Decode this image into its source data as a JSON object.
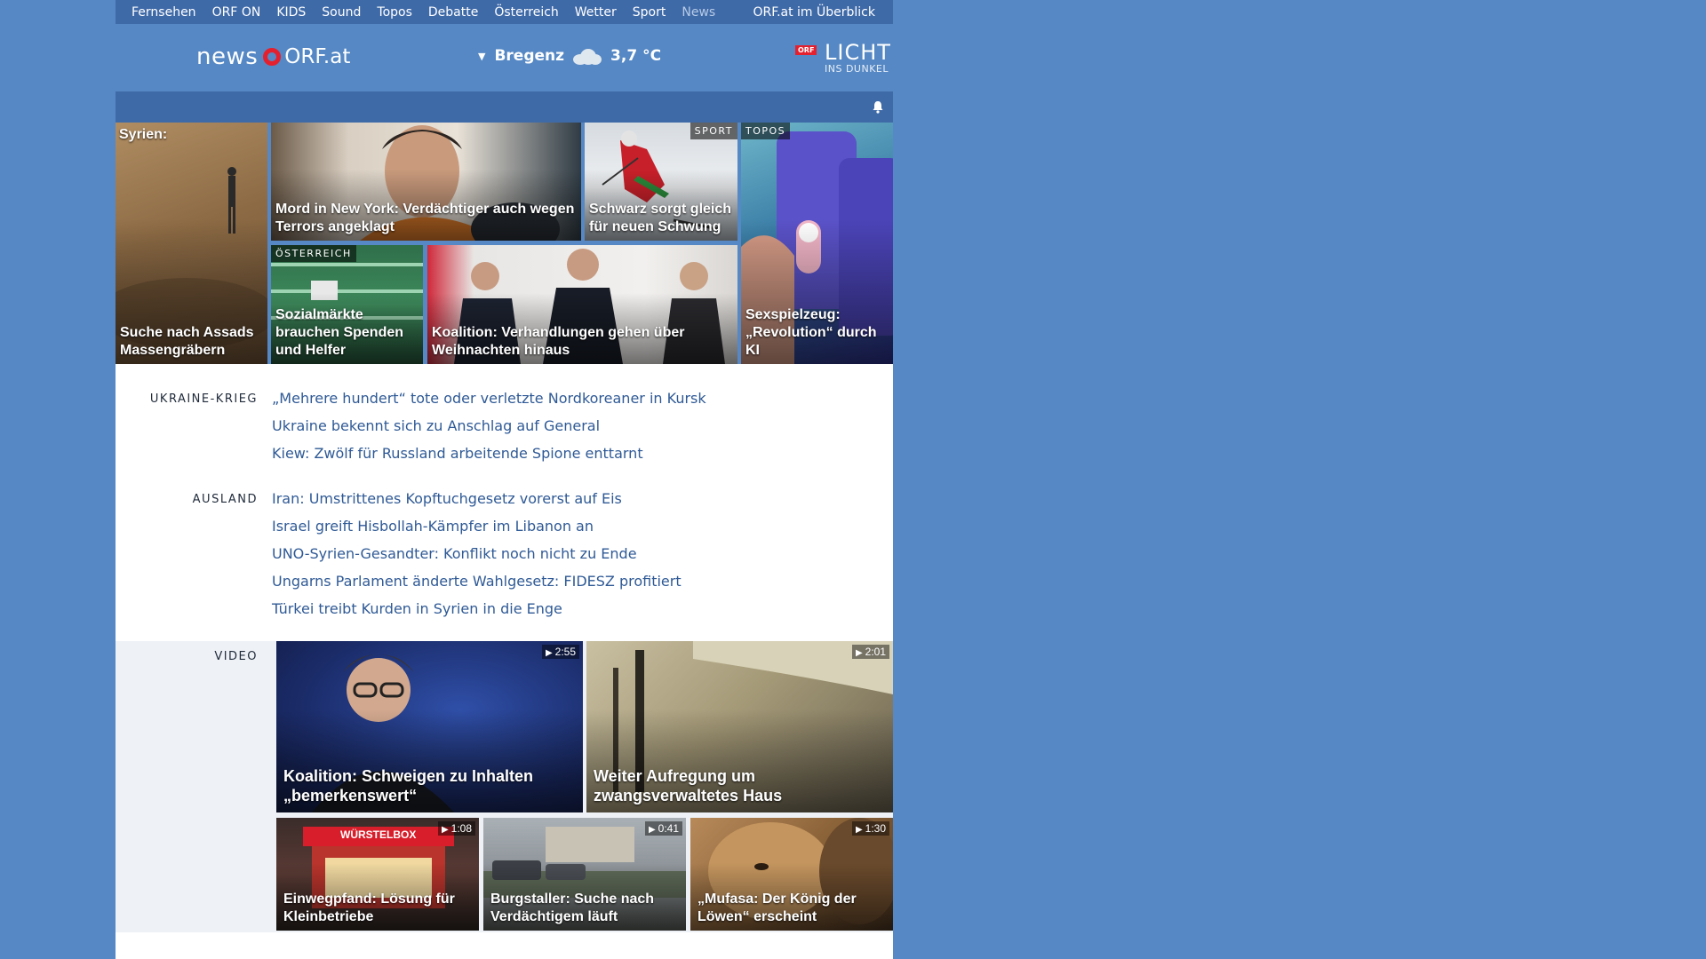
{
  "topnav": {
    "items": [
      "Fernsehen",
      "ORF ON",
      "KIDS",
      "Sound",
      "Topos",
      "Debatte",
      "Österreich",
      "Wetter",
      "Sport",
      "News"
    ],
    "overview": "ORF.at im Überblick"
  },
  "header": {
    "logo_news": "news",
    "logo_orf": "ORF.at",
    "weather_city": "Bregenz",
    "weather_temp": "3,7 °C",
    "licht_badge": "ORF",
    "licht_big": "LICHT",
    "licht_small": "INS DUNKEL"
  },
  "teasers": {
    "syrien": {
      "label": "Syrien:",
      "caption": "Suche nach Assads Massengräbern"
    },
    "newyork": {
      "caption": "Mord in New York: Verdächtiger auch wegen Terrors angeklagt"
    },
    "sport": {
      "tag": "SPORT",
      "caption": "Schwarz sorgt gleich für neuen Schwung"
    },
    "topos": {
      "tag": "TOPOS",
      "caption": "Sexspielzeug: „Revolution“ durch KI"
    },
    "oesterreich": {
      "tag": "ÖSTERREICH",
      "caption": "Sozialmärkte brauchen Spenden und Helfer"
    },
    "koalition": {
      "caption": "Koalition: Verhandlungen gehen über Weihnachten hinaus"
    }
  },
  "sections": {
    "ukraine": {
      "label": "UKRAINE-KRIEG",
      "stories": [
        "„Mehrere hundert“ tote oder verletzte Nordkoreaner in Kursk",
        "Ukraine bekennt sich zu Anschlag auf General",
        "Kiew: Zwölf für Russland arbeitende Spione enttarnt"
      ]
    },
    "ausland": {
      "label": "AUSLAND",
      "stories": [
        "Iran: Umstrittenes Kopftuchgesetz vorerst auf Eis",
        "Israel greift Hisbollah-Kämpfer im Libanon an",
        "UNO-Syrien-Gesandter: Konflikt noch nicht zu Ende",
        "Ungarns Parlament änderte Wahlgesetz: FIDESZ profitiert",
        "Türkei treibt Kurden in Syrien in die Enge"
      ]
    }
  },
  "video": {
    "label": "VIDEO",
    "items": [
      {
        "duration": "2:55",
        "caption": "Koalition: Schweigen zu Inhalten „bemerkenswert“"
      },
      {
        "duration": "2:01",
        "caption": "Weiter Aufregung um zwangsverwaltetes Haus"
      },
      {
        "duration": "1:08",
        "caption": "Einwegpfand: Lösung für Kleinbetriebe",
        "sign": "WÜRSTELBOX"
      },
      {
        "duration": "0:41",
        "caption": "Burgstaller: Suche nach Verdächtigem läuft"
      },
      {
        "duration": "1:30",
        "caption": "„Mufasa: Der König der Löwen“ erscheint"
      }
    ]
  },
  "colors": {
    "background": "#5588c4",
    "nav": "#3f6aa8",
    "link": "#2f5a96",
    "orf_red": "#e5202e"
  }
}
